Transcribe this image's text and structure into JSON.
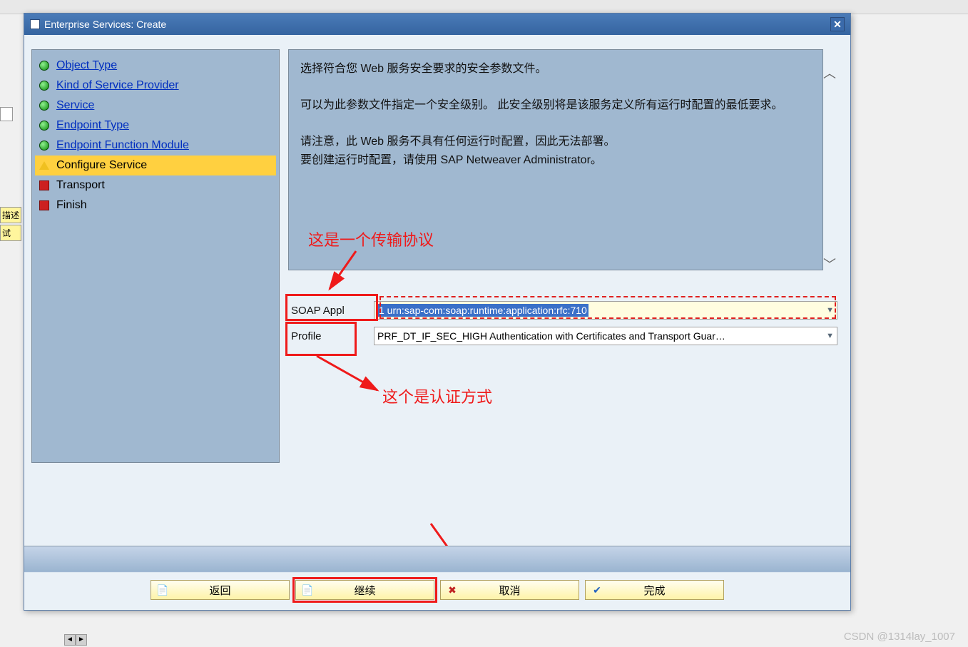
{
  "titlebar": {
    "title": "Enterprise Services: Create"
  },
  "sidebar": {
    "steps": [
      {
        "label": "Object Type",
        "state": "done"
      },
      {
        "label": "Kind of Service Provider",
        "state": "done"
      },
      {
        "label": "Service",
        "state": "done"
      },
      {
        "label": "Endpoint Type",
        "state": "done"
      },
      {
        "label": "Endpoint Function Module",
        "state": "done"
      },
      {
        "label": "Configure Service",
        "state": "active"
      },
      {
        "label": "Transport",
        "state": "pending"
      },
      {
        "label": "Finish",
        "state": "pending"
      }
    ]
  },
  "description": {
    "p1": "选择符合您 Web 服务安全要求的安全参数文件。",
    "p2": "可以为此参数文件指定一个安全级别。 此安全级别将是该服务定义所有运行时配置的最低要求。",
    "p3": "请注意，此 Web 服务不具有任何运行时配置，因此无法部署。",
    "p4": "要创建运行时配置，请使用 SAP Netweaver Administrator。"
  },
  "form": {
    "soap_label": "SOAP Appl",
    "soap_value": "1 urn:sap-com:soap:runtime:application:rfc:710",
    "profile_label": "Profile",
    "profile_value": "PRF_DT_IF_SEC_HIGH Authentication with Certificates and Transport Guar…"
  },
  "annotations": {
    "a1": "这是一个传输协议",
    "a2": "这个是认证方式"
  },
  "footer": {
    "back": "返回",
    "continue": "继续",
    "cancel": "取消",
    "finish": "完成"
  },
  "bg_tabs": {
    "t1": "描述",
    "t2": "试"
  },
  "watermark": "CSDN @1314lay_1007"
}
